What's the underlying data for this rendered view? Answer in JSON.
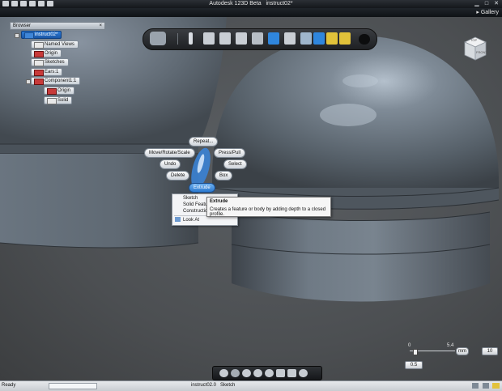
{
  "window": {
    "title": "Autodesk 123D Beta",
    "document": "instruct02*",
    "gallery_label": "Gallery"
  },
  "browser": {
    "title": "Browser",
    "close_glyph": "×",
    "root": "instruct02*",
    "items": [
      {
        "label": "Named Views"
      },
      {
        "label": "Origin"
      },
      {
        "label": "Sketches"
      },
      {
        "label": "Ears:1"
      },
      {
        "label": "Component1:1"
      },
      {
        "label": "Origin"
      },
      {
        "label": "Solid"
      }
    ]
  },
  "marking_menu": {
    "repeat": "Repeat...",
    "move": "Move/Rotate/Scale",
    "press_pull": "Press/Pull",
    "undo": "Undo",
    "select": "Select",
    "delete": "Delete",
    "box": "Box",
    "extrude": "Extrude"
  },
  "context_menu": {
    "items": [
      "Sketch",
      "Solid Features",
      "Construction",
      "Look At"
    ]
  },
  "tooltip": {
    "title": "Extrude",
    "description": "Creates a feature or body by adding depth to a closed profile."
  },
  "viewcube": {
    "top": "TOP",
    "front": "FRONT"
  },
  "grid": {
    "ticks": [
      "0",
      "5.4"
    ],
    "unit": "mm",
    "value": "0.5",
    "size": "10"
  },
  "status": {
    "ready": "Ready",
    "document": "instruct02.0",
    "mode": "Sketch"
  },
  "colors": {
    "accent": "#2b79cf",
    "body": "#5f6973",
    "body_highlight": "#a7b4c2",
    "viewport": "#4e5154"
  }
}
